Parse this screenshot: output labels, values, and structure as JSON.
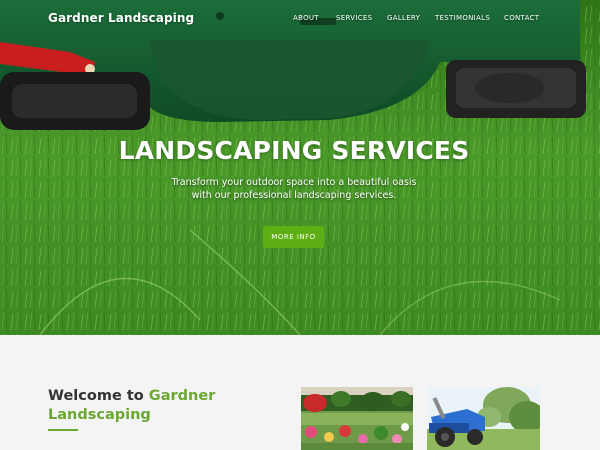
{
  "brand": {
    "name": "Gardner Landscaping"
  },
  "nav": {
    "items": [
      {
        "label": "ABOUT"
      },
      {
        "label": "SERVICES"
      },
      {
        "label": "GALLERY"
      },
      {
        "label": "TESTIMONIALS"
      },
      {
        "label": "CONTACT"
      }
    ]
  },
  "hero": {
    "title": "LANDSCAPING SERVICES",
    "subtitle_line1": "Transform your outdoor space into a beautiful oasis",
    "subtitle_line2": "with our professional landscaping services.",
    "cta_label": "MORE INFO"
  },
  "welcome": {
    "title_prefix": "Welcome to",
    "title_accent_1": "Gardner",
    "title_accent_2": "Landscaping"
  },
  "colors": {
    "accent_green": "#6aa833",
    "button_green": "#5eae16",
    "text_dark": "#333333",
    "section_bg": "#f4f4f4"
  }
}
